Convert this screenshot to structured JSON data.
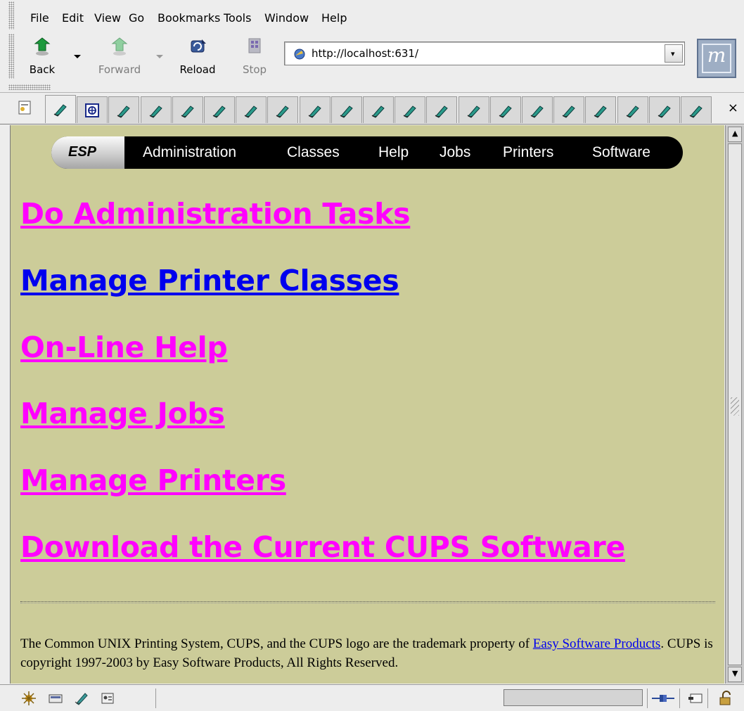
{
  "menu": {
    "items": [
      "File",
      "Edit",
      "View",
      "Go",
      "Bookmarks",
      "Tools",
      "Window",
      "Help"
    ]
  },
  "toolbar": {
    "back_label": "Back",
    "forward_label": "Forward",
    "reload_label": "Reload",
    "stop_label": "Stop"
  },
  "urlbar": {
    "url": "http://localhost:631/"
  },
  "colors": {
    "page_background": "#cccc99",
    "visited_link": "#ff00ff",
    "unvisited_link": "#0000ee",
    "esp_bar": "#000000"
  },
  "nav_bar": {
    "logo": "ESP",
    "links": [
      "Administration",
      "Classes",
      "Help",
      "Jobs",
      "Printers",
      "Software"
    ]
  },
  "main_links": [
    {
      "label": "Do Administration Tasks",
      "visited": true
    },
    {
      "label": "Manage Printer Classes",
      "visited": false
    },
    {
      "label": "On-Line Help",
      "visited": true
    },
    {
      "label": "Manage Jobs",
      "visited": true
    },
    {
      "label": "Manage Printers",
      "visited": true
    },
    {
      "label": "Download the Current CUPS Software",
      "visited": true
    }
  ],
  "footer": {
    "text_1": "The Common UNIX Printing System, CUPS, and the CUPS logo are the trademark property of ",
    "link": "Easy Software Products",
    "text_2": ". CUPS is copyright 1997-2003 by Easy Software Products, All Rights Reserved."
  },
  "tab_close": "×",
  "throbber_letter": "m",
  "url_dropdown_glyph": "▾",
  "scroll_up_glyph": "▲",
  "scroll_down_glyph": "▼"
}
